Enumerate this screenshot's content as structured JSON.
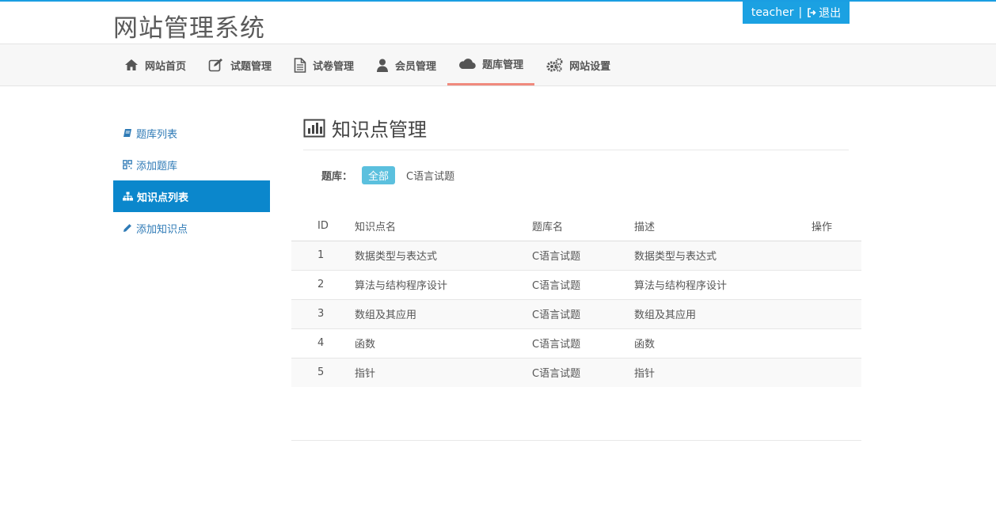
{
  "header": {
    "site_title": "网站管理系统",
    "user": "teacher",
    "separator": "|",
    "logout_label": "退出"
  },
  "nav": {
    "items": [
      {
        "label": "网站首页",
        "icon": "home-icon"
      },
      {
        "label": "试题管理",
        "icon": "edit-icon"
      },
      {
        "label": "试卷管理",
        "icon": "file-icon"
      },
      {
        "label": "会员管理",
        "icon": "user-icon"
      },
      {
        "label": "题库管理",
        "icon": "cloud-icon"
      },
      {
        "label": "网站设置",
        "icon": "gears-icon"
      }
    ],
    "active_index": 4,
    "active_color": "#f08a7e"
  },
  "sidebar": {
    "items": [
      {
        "label": "题库列表",
        "icon": "book-icon"
      },
      {
        "label": "添加题库",
        "icon": "qrcode-icon"
      },
      {
        "label": "知识点列表",
        "icon": "sitemap-icon"
      },
      {
        "label": "添加知识点",
        "icon": "pencil-icon"
      }
    ],
    "active_index": 2,
    "active_color": "#0b87cc"
  },
  "main": {
    "title": "知识点管理",
    "title_icon": "bar-chart-icon",
    "filter": {
      "label": "题库：",
      "options": [
        "全部",
        "C语言试题"
      ],
      "selected": "全部"
    },
    "table": {
      "columns": [
        "ID",
        "知识点名",
        "题库名",
        "描述",
        "操作"
      ],
      "rows": [
        {
          "id": "1",
          "name": "数据类型与表达式",
          "bank": "C语言试题",
          "desc": "数据类型与表达式",
          "op": ""
        },
        {
          "id": "2",
          "name": "算法与结构程序设计",
          "bank": "C语言试题",
          "desc": "算法与结构程序设计",
          "op": ""
        },
        {
          "id": "3",
          "name": "数组及其应用",
          "bank": "C语言试题",
          "desc": "数组及其应用",
          "op": ""
        },
        {
          "id": "4",
          "name": "函数",
          "bank": "C语言试题",
          "desc": "函数",
          "op": ""
        },
        {
          "id": "5",
          "name": "指针",
          "bank": "C语言试题",
          "desc": "指针",
          "op": ""
        }
      ]
    }
  },
  "colors": {
    "accent": "#1ba1e2",
    "tag": "#5bc0de"
  }
}
